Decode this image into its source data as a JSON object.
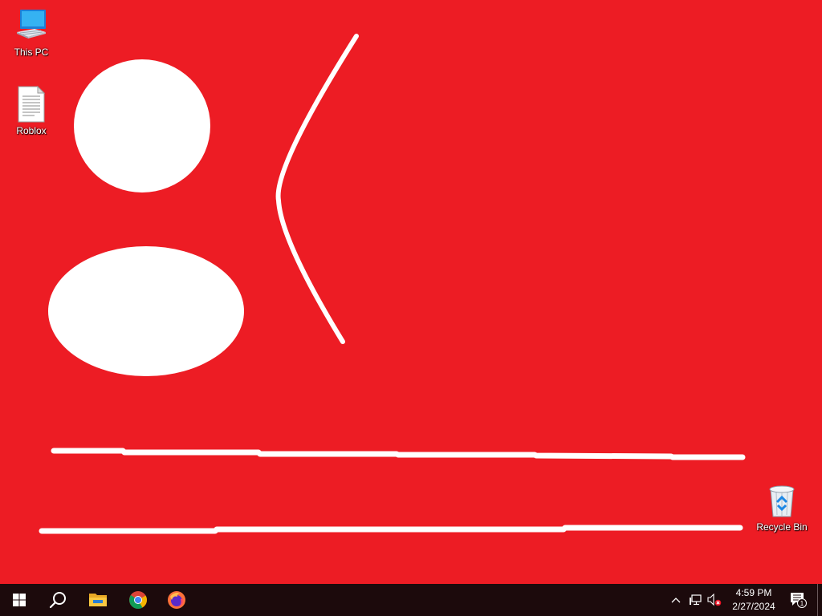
{
  "desktop": {
    "background_color": "#ed1c24",
    "drawing_color": "#ffffff",
    "icons": [
      {
        "label": "This PC",
        "icon": "this-pc-icon"
      },
      {
        "label": "Roblox",
        "icon": "text-document-icon"
      },
      {
        "label": "Recycle Bin",
        "icon": "recycle-bin-icon"
      }
    ]
  },
  "taskbar": {
    "background_color": "#1c0a0c",
    "pinned": [
      {
        "name": "start",
        "icon": "windows-logo-icon"
      },
      {
        "name": "search",
        "icon": "search-icon"
      },
      {
        "name": "file-explorer",
        "icon": "folder-icon"
      },
      {
        "name": "chrome",
        "icon": "chrome-icon"
      },
      {
        "name": "firefox",
        "icon": "firefox-icon"
      }
    ],
    "tray": {
      "icons": [
        "chevron-up-icon",
        "network-icon",
        "volume-muted-icon"
      ],
      "time": "4:59 PM",
      "date": "2/27/2024",
      "notification_count": "1"
    }
  }
}
